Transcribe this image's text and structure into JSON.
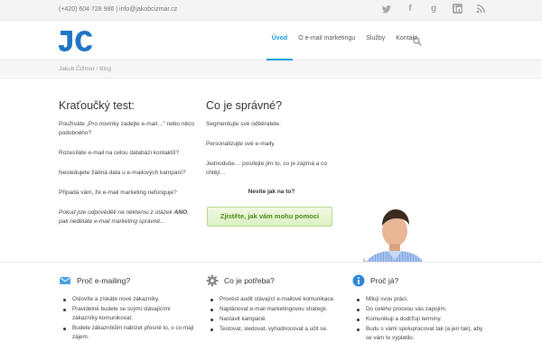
{
  "topbar": {
    "contact": "(+420) 604 728 986 | info@jakobcizmar.cz",
    "social_icons": [
      "twitter-icon",
      "facebook-icon",
      "google-plus-icon",
      "linkedin-icon",
      "rss-icon"
    ]
  },
  "header": {
    "logo_text": "JC",
    "nav": [
      "Úvod",
      "O e-mail marketingu",
      "Služby",
      "Kontakt"
    ]
  },
  "breadcrumb": "Jakub Čižmar / Blog",
  "left": {
    "title": "Kraťoučký test:",
    "paragraphs": [
      "Používáte „Pro novinky zadejte e-mail…“ nebo něco podobného?",
      "Rozesíláte e-mail na celou databázi kontaktů?",
      "Nesledujete žádná data u e-mailových kampaní?",
      "Připadá vám, že e-mail marketing nefunguje?"
    ],
    "note_prefix": "Pokud jste odpověděli na některou z otázek ",
    "note_bold": "ANO",
    "note_suffix": ", pak neděláte e-mail marketing správně…"
  },
  "middle": {
    "title": "Co je správné?",
    "paragraphs": [
      "Segmentujte své odběratele.",
      "Personalizujte své e-maily.",
      "Jednoduše… posílejte jim to, co je zajímá a co chtějí…"
    ],
    "bold_line": "Nevíte jak na to?",
    "cta": "Zjistěte, jak vám mohu pomoci"
  },
  "features": [
    {
      "title": "Proč e-mailing?",
      "icon": "email-icon",
      "items": [
        "Oslovíte a získáte nové zákazníky.",
        "Pravidelně budete se svými stávajícími zákazníky komunikovat.",
        "Budete zákazníkům nabízet přesně to, o co mají zájem."
      ]
    },
    {
      "title": "Co je potřeba?",
      "icon": "gear-icon",
      "items": [
        "Provést audit stávající e-mailové komunikace.",
        "Naplánovat e-mail marketingovou strategii.",
        "Nastavit kampaně.",
        "Testovat, sledovat, vyhodnocovat a učit se."
      ]
    },
    {
      "title": "Proč já?",
      "icon": "info-icon",
      "items": [
        "Miluji svou práci.",
        "Do celého procesu vás zapojím.",
        "Komunikuji a dodržuji termíny.",
        "Budu s vámi spolupracovat tak (a jen tak), aby se vám to vyplatilo."
      ]
    }
  ],
  "colors": {
    "accent": "#1a9be0",
    "logo": "#1f76c4",
    "cta_text": "#4d8a1a"
  }
}
